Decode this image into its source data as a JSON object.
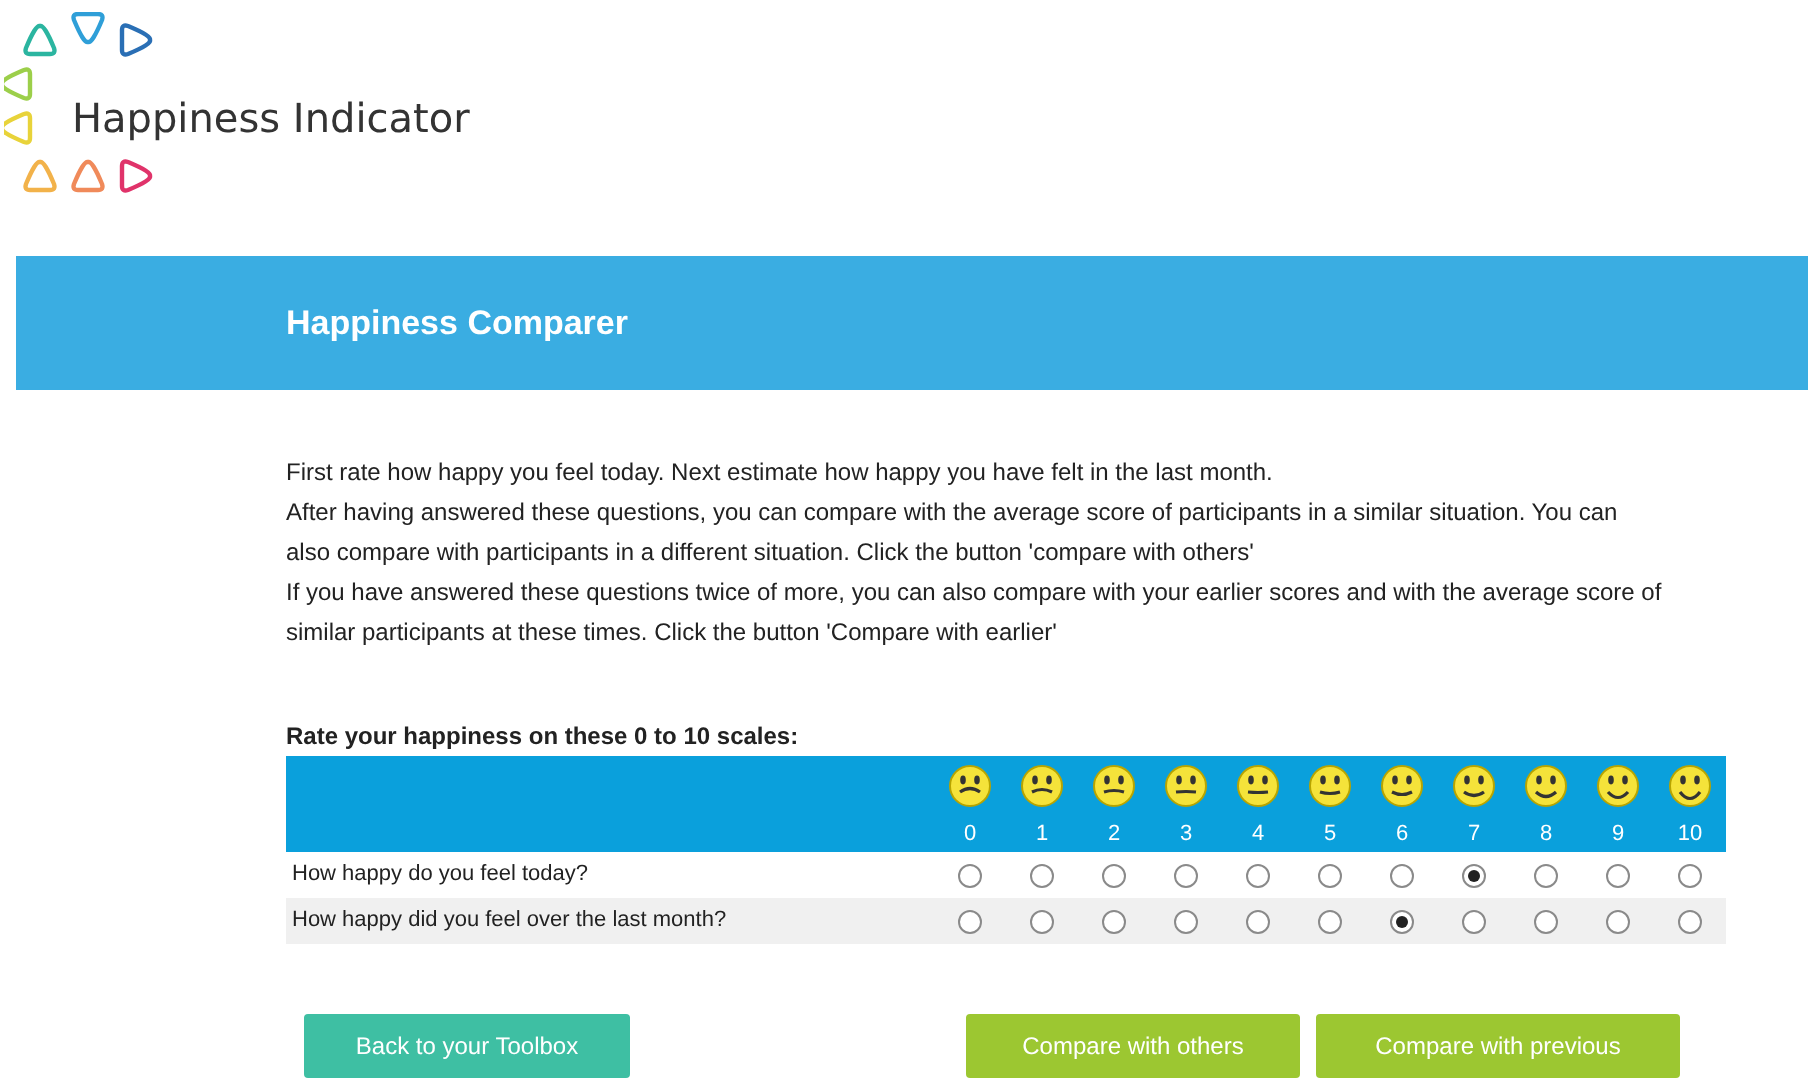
{
  "brand": {
    "name": "Happiness Indicator"
  },
  "banner": {
    "title": "Happiness Comparer"
  },
  "intro": [
    "First rate how happy you feel today. Next estimate how happy you have felt in the last month.",
    "After having answered these questions, you can compare with the average score of participants in a similar situation. You can also compare with participants in a different situation. Click the button 'compare with others'",
    "If you have answered these questions twice of more, you can also compare with your earlier scores and with the average score of similar participants at these times. Click the button 'Compare with earlier'"
  ],
  "scale": {
    "heading": "Rate your happiness on these 0 to 10 scales:",
    "points": [
      "0",
      "1",
      "2",
      "3",
      "4",
      "5",
      "6",
      "7",
      "8",
      "9",
      "10"
    ],
    "questions": [
      {
        "label": "How happy do you feel today?",
        "options": [
          {
            "selected": false
          },
          {
            "selected": false
          },
          {
            "selected": false
          },
          {
            "selected": false
          },
          {
            "selected": false
          },
          {
            "selected": false
          },
          {
            "selected": false
          },
          {
            "selected": true
          },
          {
            "selected": false
          },
          {
            "selected": false
          },
          {
            "selected": false
          }
        ]
      },
      {
        "label": "How happy did you feel over the last month?",
        "options": [
          {
            "selected": false
          },
          {
            "selected": false
          },
          {
            "selected": false
          },
          {
            "selected": false
          },
          {
            "selected": false
          },
          {
            "selected": false
          },
          {
            "selected": true
          },
          {
            "selected": false
          },
          {
            "selected": false
          },
          {
            "selected": false
          },
          {
            "selected": false
          }
        ]
      }
    ]
  },
  "buttons": [
    {
      "label": "Back to your Toolbox",
      "kind": "back"
    },
    {
      "label": "Compare with others",
      "kind": "compare"
    },
    {
      "label": "Compare with previous",
      "kind": "compare"
    }
  ]
}
